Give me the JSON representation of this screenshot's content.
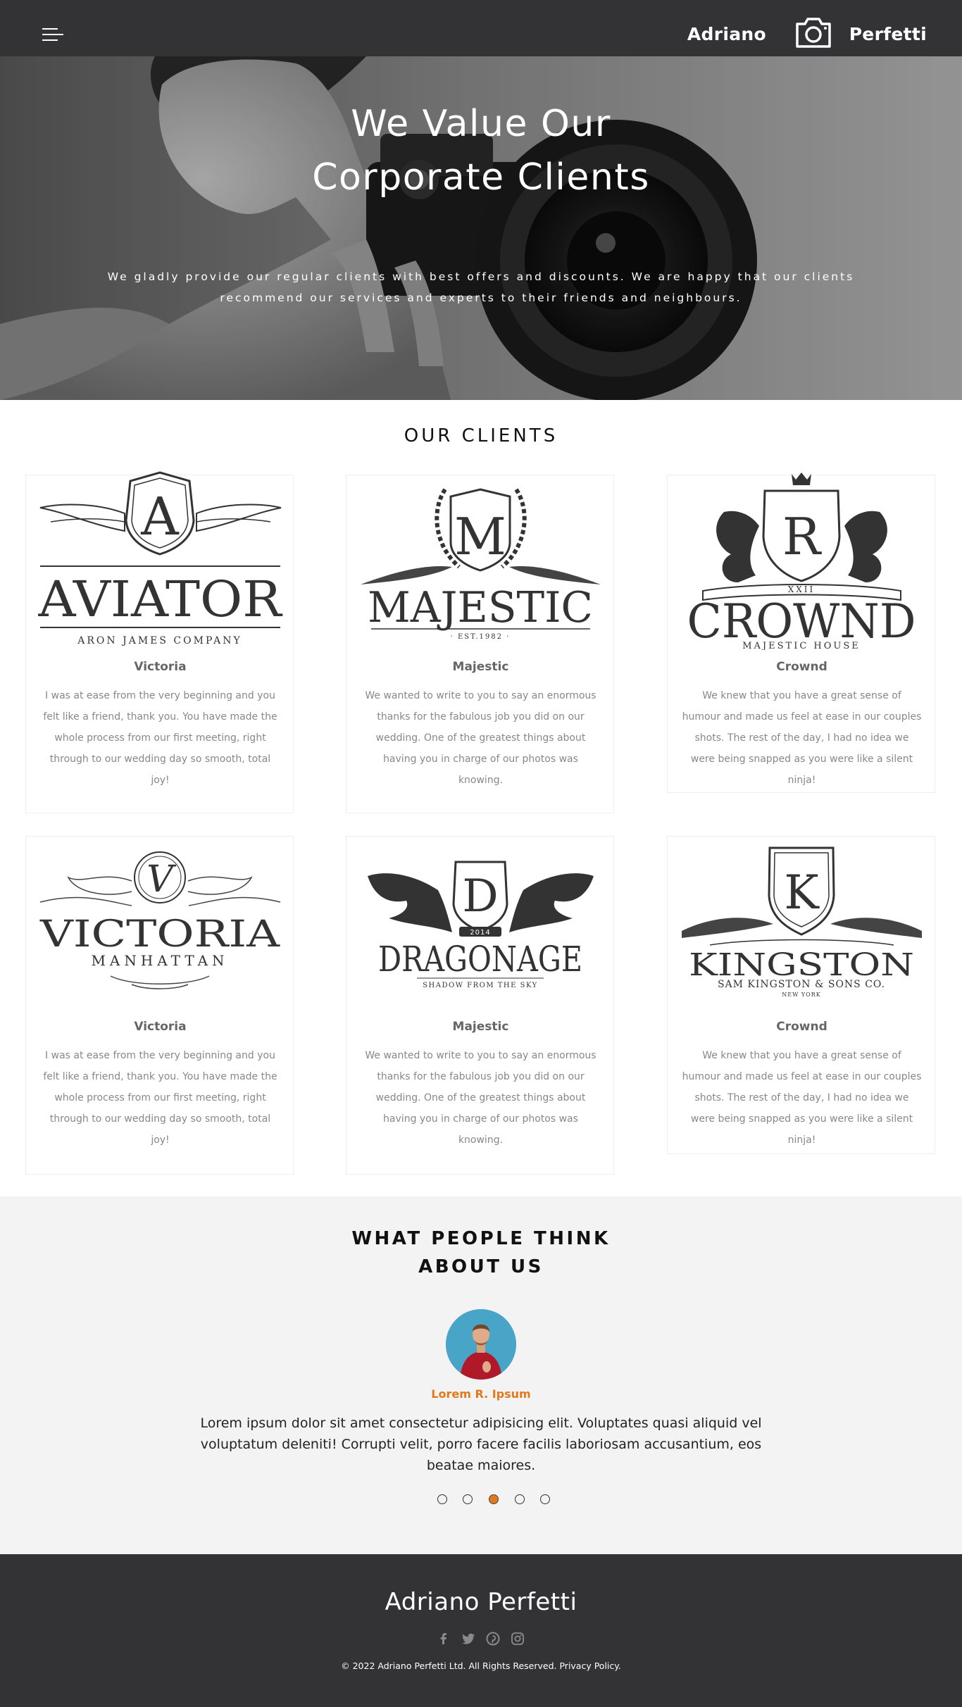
{
  "header": {
    "brand_first": "Adriano",
    "brand_last": "Perfetti",
    "menu_icon": "hamburger-icon",
    "logo_icon": "camera-icon"
  },
  "hero": {
    "title": "We Value Our Corporate Clients",
    "subtitle": "We gladly provide our regular clients with best offers and discounts. We are happy that our clients recommend our services and experts to their friends and neighbours."
  },
  "clients": {
    "title": "OUR CLIENTS",
    "cards": [
      {
        "logo": {
          "letter": "A",
          "name": "AVIATOR",
          "tagline": "ARON JAMES COMPANY"
        },
        "name": "Victoria",
        "text": "I was at ease from the very beginning and you felt like a friend, thank you. You have made the whole process from our first meeting, right through to our wedding day so smooth, total joy!"
      },
      {
        "logo": {
          "letter": "M",
          "name": "MAJESTIC",
          "tagline": "· EST.1982 ·"
        },
        "name": "Majestic",
        "text": "We wanted to write to you to say an enormous thanks for the fabulous job you did on our wedding. One of the greatest things about having you in charge of our photos was knowing."
      },
      {
        "logo": {
          "letter": "R",
          "name": "CROWND",
          "tagline": "MAJESTIC HOUSE",
          "number": "XXII"
        },
        "name": "Crownd",
        "text": "We knew that you have a great sense of humour and made us feel at ease in our couples shots. The rest of the day, I had no idea we were being snapped as you were like a silent ninja!"
      },
      {
        "logo": {
          "letter": "V",
          "name": "VICTORIA",
          "tagline": "MANHATTAN"
        },
        "name": "Victoria",
        "text": "I was at ease from the very beginning and you felt like a friend, thank you. You have made the whole process from our first meeting, right through to our wedding day so smooth, total joy!"
      },
      {
        "logo": {
          "letter": "D",
          "name": "DRAGONAGE",
          "tagline": "SHADOW FROM THE SKY",
          "number": "2014"
        },
        "name": "Majestic",
        "text": "We wanted to write to you to say an enormous thanks for the fabulous job you did on our wedding. One of the greatest things about having you in charge of our photos was knowing."
      },
      {
        "logo": {
          "letter": "K",
          "name": "KINGSTON",
          "tagline": "SAM KINGSTON & SONS CO.",
          "subtag": "NEW YORK"
        },
        "name": "Crownd",
        "text": "We knew that you have a great sense of humour and made us feel at ease in our couples shots. The rest of the day, I had no idea we were being snapped as you were like a silent ninja!"
      }
    ]
  },
  "testimonials": {
    "title_line1": "WHAT PEOPLE THINK",
    "title_line2": "ABOUT US",
    "name": "Lorem R. Ipsum",
    "text": "Lorem ipsum dolor sit amet consectetur adipisicing elit. Voluptates quasi aliquid vel voluptatum deleniti! Corrupti velit, porro facere facilis laboriosam accusantium, eos beatae maiores.",
    "slide_count": 5,
    "active_slide": 3
  },
  "footer": {
    "brand": "Adriano Perfetti",
    "socials": [
      "facebook-icon",
      "twitter-icon",
      "pinterest-icon",
      "instagram-icon"
    ],
    "copyright": "© 2022 Adriano Perfetti Ltd. All Rights Reserved.",
    "privacy": "Privacy Policy."
  },
  "colors": {
    "dark": "#333335",
    "accent": "#e07a1c",
    "light_bg": "#f3f3f3"
  }
}
